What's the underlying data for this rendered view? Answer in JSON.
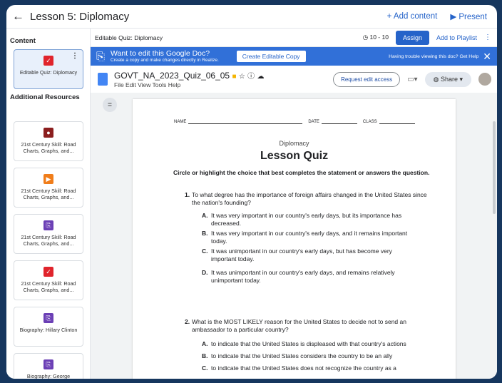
{
  "topbar": {
    "back_glyph": "←",
    "title": "Lesson 5: Diplomacy",
    "add_content": "+ Add content",
    "present": "▶ Present"
  },
  "sidebar": {
    "content_header": "Content",
    "additional_header": "Additional Resources",
    "active_item": {
      "label": "Editable Quiz: Diplomacy",
      "icon": "quiz-icon",
      "color": "#e0242c"
    },
    "resources": [
      {
        "label": "21st Century Skill: Road Charts, Graphs, and...",
        "icon": "bomb-icon",
        "color": "#8b1e1e"
      },
      {
        "label": "21st Century Skill: Road Charts, Graphs, and...",
        "icon": "play-icon",
        "color": "#f07d1a"
      },
      {
        "label": "21st Century Skill: Road Charts, Graphs, and...",
        "icon": "copy-icon",
        "color": "#6b3fb5"
      },
      {
        "label": "21st Century Skill: Road Charts, Graphs, and...",
        "icon": "quiz-icon",
        "color": "#e0242c"
      },
      {
        "label": "Biography: Hillary Clinton",
        "icon": "copy-icon",
        "color": "#6b3fb5"
      },
      {
        "label": "Biography: George Marshall",
        "icon": "copy-icon",
        "color": "#6b3fb5"
      }
    ]
  },
  "toolbar": {
    "title": "Editable Quiz: Diplomacy",
    "timer": "10 - 10",
    "assign": "Assign",
    "playlist": "Add to Playlist"
  },
  "banner": {
    "title": "Want to edit this Google Doc?",
    "subtitle": "Create a copy and make changes directly in Realize.",
    "button": "Create Editable Copy",
    "trouble": "Having trouble viewing this doc? Get Help"
  },
  "doc": {
    "title": "GOVT_NA_2023_Quiz_06_05",
    "menus": "File   Edit   View   Tools   Help",
    "request": "Request edit access",
    "share": "Share"
  },
  "quiz": {
    "name_label": "NAME",
    "date_label": "DATE",
    "class_label": "CLASS",
    "subject": "Diplomacy",
    "title": "Lesson Quiz",
    "instruction": "Circle or highlight the choice that best completes the statement or answers the question.",
    "questions": [
      {
        "n": "1.",
        "text": "To what degree has the importance of foreign affairs changed in the United States since the nation's founding?",
        "options": [
          {
            "l": "A.",
            "t": "It was very important in our country's early days, but its importance has decreased."
          },
          {
            "l": "B.",
            "t": "It was very important in our country's early days, and it remains important today."
          },
          {
            "l": "C.",
            "t": "It was unimportant in our country's early days, but has become very important today."
          },
          {
            "l": "D.",
            "t": "It was unimportant in our country's early days, and remains relatively unimportant today."
          }
        ]
      },
      {
        "n": "2.",
        "text": "What is the MOST LIKELY reason for the United States to decide not to send an ambassador to a particular country?",
        "options": [
          {
            "l": "A.",
            "t": "to indicate that the United States is displeased with that country's actions"
          },
          {
            "l": "B.",
            "t": "to indicate that the United States considers the country to be an ally"
          },
          {
            "l": "C.",
            "t": "to indicate that the United States does not recognize the country as a"
          }
        ]
      }
    ]
  }
}
